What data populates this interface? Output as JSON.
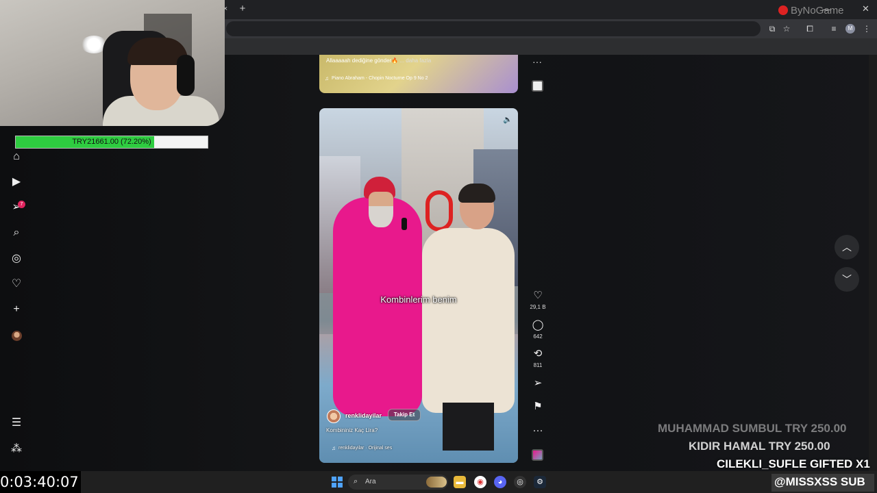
{
  "browser": {
    "tab_close": "×",
    "new_tab": "+",
    "minimize": "—",
    "close": "✕",
    "profile_initial": "M"
  },
  "overlay": {
    "watermark": "ByNoGame",
    "donation_text": "TRY21661.00 (72.20%)",
    "donation_progress": 0.722,
    "timer": "0:03:40:07",
    "alerts": [
      "MUHAMMAD SUMBUL  TRY 250.00",
      "KIDIR HAMAL  TRY 250.00",
      "CILEKLI_SUFLE  GIFTED X1"
    ],
    "sub_label": "@MISSXSS  SUB"
  },
  "nav": {
    "badge_count": "7",
    "icons": [
      "home-icon",
      "video-icon",
      "messages-icon",
      "search-icon",
      "explore-icon",
      "heart-icon",
      "plus-icon",
      "profile-icon",
      "menu-icon",
      "more-apps-icon"
    ]
  },
  "prev_video": {
    "caption": "Allaaaaah dediğine gönder🔥",
    "more_link": "... daha fazla",
    "music": "Piano Abraham - Chopin Nocturne Op 9 No 2"
  },
  "video": {
    "subtitle": "Kombinlerim benim",
    "creator": "renklidayilar",
    "follow_label": "Takip Et",
    "caption": "Kombininiz Kaç Lira?",
    "music": "renklidayilar · Orijinal ses"
  },
  "actions": {
    "likes": "29,1 B",
    "comments": "642",
    "reposts": "811",
    "more": "···"
  },
  "taskbar": {
    "search_placeholder": "Ara"
  }
}
